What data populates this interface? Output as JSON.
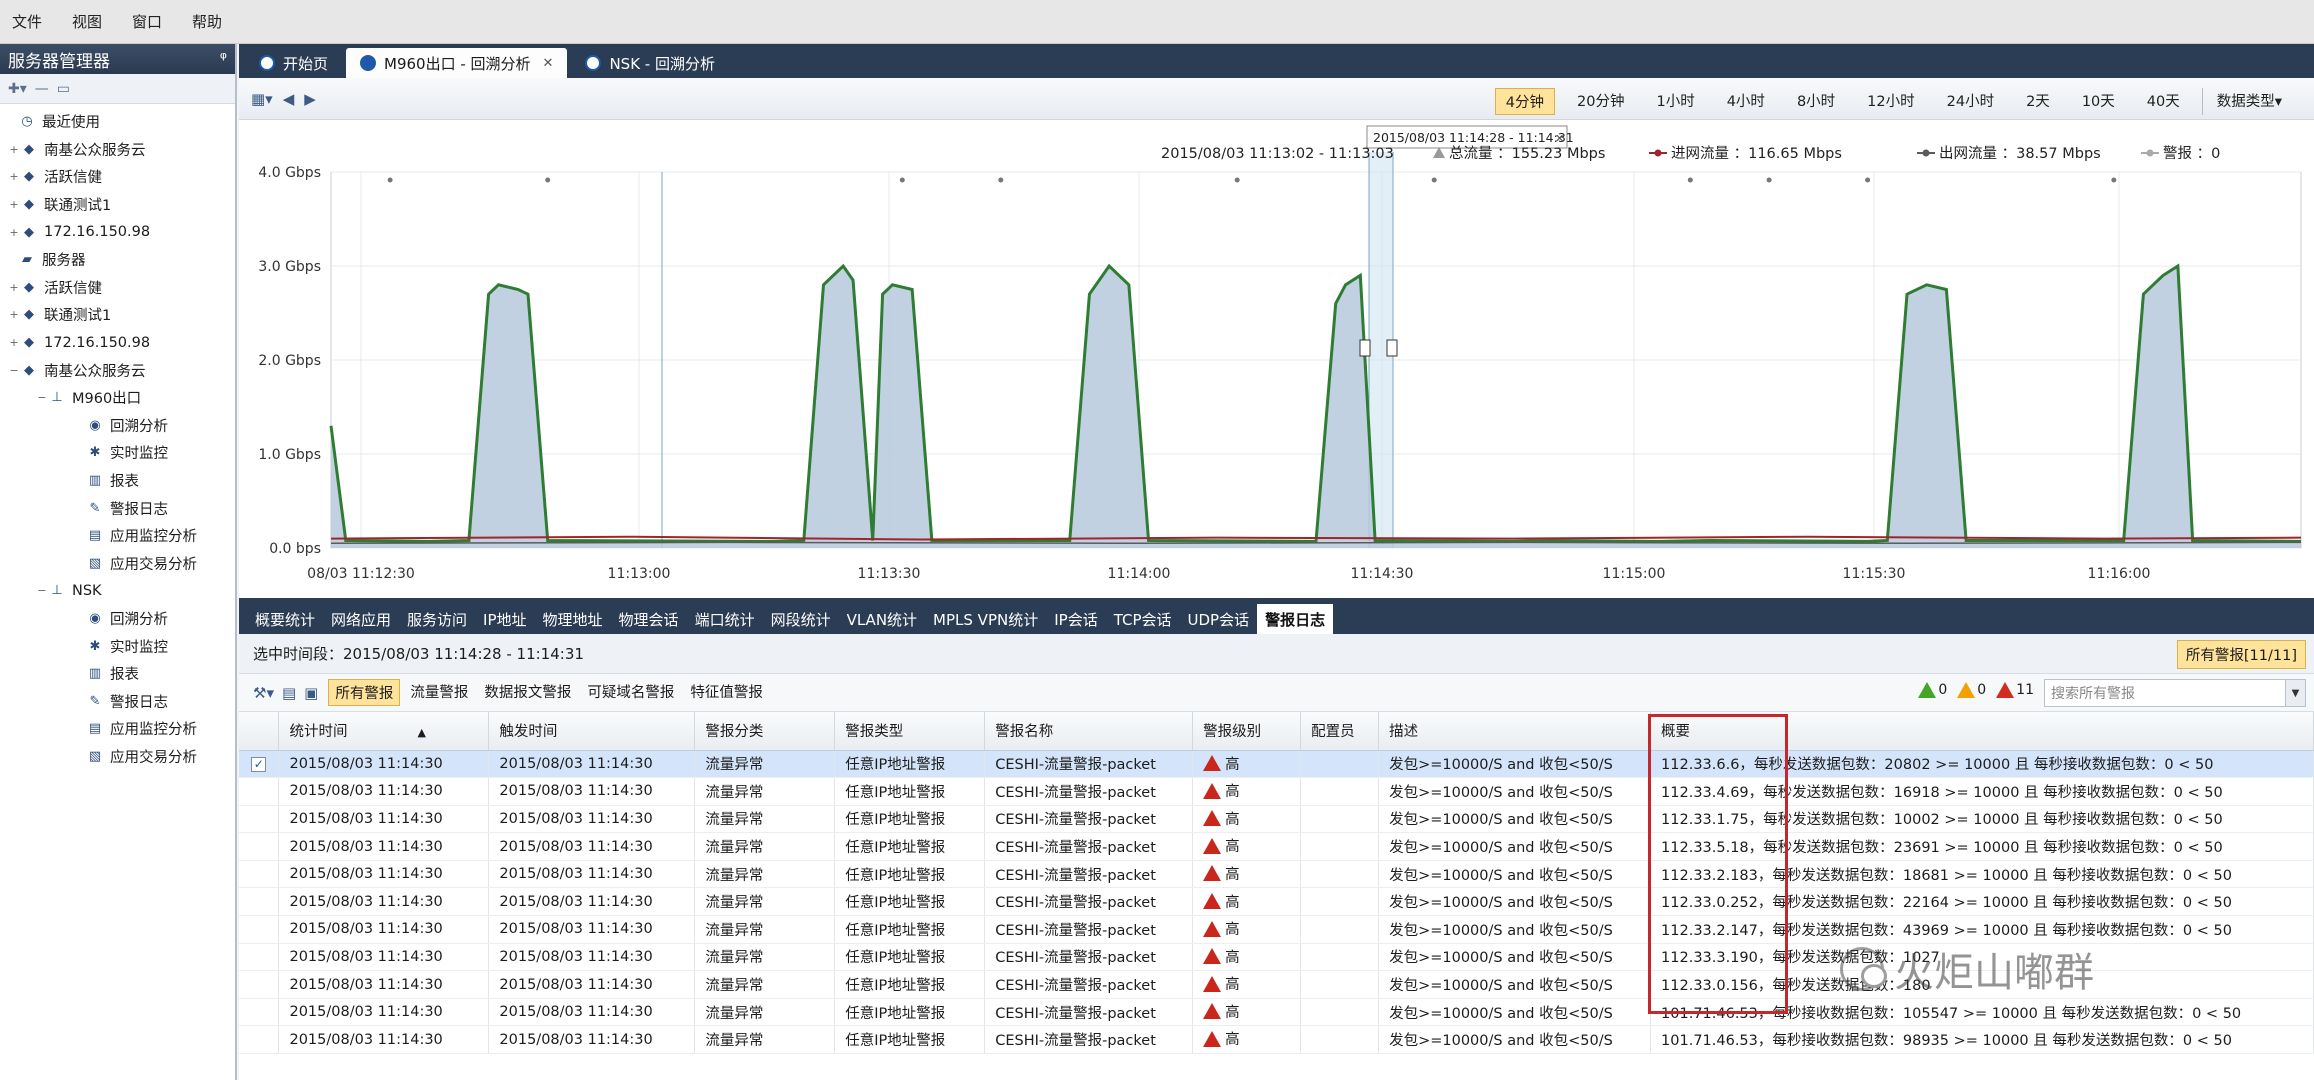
{
  "menu": [
    "文件",
    "视图",
    "窗口",
    "帮助"
  ],
  "left_panel": {
    "title": "服务器管理器",
    "pin": "ᵠ",
    "tree": [
      {
        "label": "最近使用",
        "level": 0,
        "icon": "clock-icon",
        "toggle": ""
      },
      {
        "label": "南基公众服务云",
        "level": 1,
        "icon": "server-icon",
        "toggle": "+"
      },
      {
        "label": "活跃信健",
        "level": 1,
        "icon": "server-icon",
        "toggle": "+"
      },
      {
        "label": "联通测试1",
        "level": 1,
        "icon": "server-icon",
        "toggle": "+"
      },
      {
        "label": "172.16.150.98",
        "level": 1,
        "icon": "server-icon",
        "toggle": "+"
      },
      {
        "label": "服务器",
        "level": 0,
        "icon": "folder-icon",
        "toggle": ""
      },
      {
        "label": "活跃信健",
        "level": 1,
        "icon": "server-icon",
        "toggle": "+"
      },
      {
        "label": "联通测试1",
        "level": 1,
        "icon": "server-icon",
        "toggle": "+"
      },
      {
        "label": "172.16.150.98",
        "level": 1,
        "icon": "server-icon",
        "toggle": "+"
      },
      {
        "label": "南基公众服务云",
        "level": 1,
        "icon": "server-icon",
        "toggle": "−"
      },
      {
        "label": "M960出口",
        "level": 2,
        "icon": "network-icon",
        "toggle": "−"
      },
      {
        "label": "回溯分析",
        "level": 3,
        "icon": "replay-icon",
        "toggle": ""
      },
      {
        "label": "实时监控",
        "level": 3,
        "icon": "monitor-icon",
        "toggle": ""
      },
      {
        "label": "报表",
        "level": 3,
        "icon": "report-icon",
        "toggle": ""
      },
      {
        "label": "警报日志",
        "level": 3,
        "icon": "log-icon",
        "toggle": ""
      },
      {
        "label": "应用监控分析",
        "level": 3,
        "icon": "app-monitor-icon",
        "toggle": ""
      },
      {
        "label": "应用交易分析",
        "level": 3,
        "icon": "app-trade-icon",
        "toggle": ""
      },
      {
        "label": "NSK",
        "level": 2,
        "icon": "network-icon",
        "toggle": "−"
      },
      {
        "label": "回溯分析",
        "level": 3,
        "icon": "replay-icon",
        "toggle": ""
      },
      {
        "label": "实时监控",
        "level": 3,
        "icon": "monitor-icon",
        "toggle": ""
      },
      {
        "label": "报表",
        "level": 3,
        "icon": "report-icon",
        "toggle": ""
      },
      {
        "label": "警报日志",
        "level": 3,
        "icon": "log-icon",
        "toggle": ""
      },
      {
        "label": "应用监控分析",
        "level": 3,
        "icon": "app-monitor-icon",
        "toggle": ""
      },
      {
        "label": "应用交易分析",
        "level": 3,
        "icon": "app-trade-icon",
        "toggle": ""
      }
    ]
  },
  "doc_tabs": [
    {
      "label": "开始页",
      "active": false,
      "closable": false
    },
    {
      "label": "M960出口 - 回溯分析",
      "active": true,
      "closable": true
    },
    {
      "label": "NSK - 回溯分析",
      "active": false,
      "closable": false
    }
  ],
  "time_ranges": [
    "4分钟",
    "20分钟",
    "1小时",
    "4小时",
    "8小时",
    "12小时",
    "24小时",
    "2天",
    "10天",
    "40天"
  ],
  "active_range": "4分钟",
  "data_type_label": "数据类型",
  "chart_data": {
    "type": "area",
    "tooltip": "2015/08/03 11:14:28 - 11:14:31",
    "legend": {
      "range": "2015/08/03  11:13:02 - 11:13:03",
      "total": "总流量 ：155.23 Mbps",
      "in": "进网流量 ：116.65 Mbps",
      "out": "出网流量 ：38.57 Mbps",
      "alarm": "警报 ：0"
    },
    "y_ticks": [
      "4.0 Gbps",
      "3.0 Gbps",
      "2.0 Gbps",
      "1.0 Gbps",
      "0.0 bps"
    ],
    "x_ticks": [
      "08/03 11:12:30",
      "11:13:00",
      "11:13:30",
      "11:14:00",
      "11:14:30",
      "11:15:00",
      "11:15:30",
      "11:16:00"
    ],
    "ylim_gbps": [
      0,
      4
    ],
    "total_gbps": [
      [
        0.0,
        1.3
      ],
      [
        1.5,
        0.08
      ],
      [
        10,
        0.07
      ],
      [
        14,
        0.08
      ],
      [
        16,
        2.7
      ],
      [
        17,
        2.8
      ],
      [
        19,
        2.75
      ],
      [
        20,
        2.7
      ],
      [
        22,
        0.08
      ],
      [
        45,
        0.07
      ],
      [
        48,
        0.08
      ],
      [
        50,
        2.8
      ],
      [
        52,
        3.0
      ],
      [
        53,
        2.85
      ],
      [
        55,
        0.08
      ],
      [
        56,
        2.7
      ],
      [
        57,
        2.8
      ],
      [
        59,
        2.75
      ],
      [
        61,
        0.08
      ],
      [
        75,
        0.08
      ],
      [
        77,
        2.7
      ],
      [
        79,
        3.0
      ],
      [
        81,
        2.8
      ],
      [
        83,
        0.08
      ],
      [
        100,
        0.07
      ],
      [
        102,
        2.6
      ],
      [
        103,
        2.8
      ],
      [
        104.5,
        2.9
      ],
      [
        106,
        0.08
      ],
      [
        120,
        0.07
      ],
      [
        124,
        0.08
      ],
      [
        135,
        0.07
      ],
      [
        140,
        0.08
      ],
      [
        156,
        0.07
      ],
      [
        158,
        0.08
      ],
      [
        160,
        2.7
      ],
      [
        162,
        2.8
      ],
      [
        164,
        2.75
      ],
      [
        166,
        0.08
      ],
      [
        182,
        0.08
      ],
      [
        184,
        2.7
      ],
      [
        186,
        2.9
      ],
      [
        187.5,
        3.0
      ],
      [
        189,
        0.08
      ],
      [
        200,
        0.07
      ]
    ],
    "in_gbps": [
      [
        0,
        0.1
      ],
      [
        30,
        0.12
      ],
      [
        60,
        0.09
      ],
      [
        90,
        0.11
      ],
      [
        120,
        0.1
      ],
      [
        150,
        0.12
      ],
      [
        180,
        0.1
      ],
      [
        200,
        0.11
      ]
    ],
    "out_gbps": [
      [
        0,
        0.05
      ],
      [
        40,
        0.06
      ],
      [
        80,
        0.05
      ],
      [
        120,
        0.06
      ],
      [
        160,
        0.05
      ],
      [
        200,
        0.06
      ]
    ],
    "alarm_markers_sec": [
      6,
      22,
      58,
      68,
      92,
      112,
      138,
      146,
      156,
      181
    ],
    "x_range_sec": [
      0,
      200
    ],
    "colors": {
      "total": "#2e7d32",
      "fill": "#b7c9dd",
      "in": "#a3232b",
      "out": "#5b5b5b",
      "selection": "#cfe4f1"
    }
  },
  "stat_tabs": [
    "概要统计",
    "网络应用",
    "服务访问",
    "IP地址",
    "物理地址",
    "物理会话",
    "端口统计",
    "网段统计",
    "VLAN统计",
    "MPLS VPN统计",
    "IP会话",
    "TCP会话",
    "UDP会话",
    "警报日志"
  ],
  "active_stat_tab": "警报日志",
  "time_range": "选中时间段：2015/08/03  11:14:28 - 11:14:31",
  "alarm_count": "所有警报[11/11]",
  "filters": [
    "所有警报",
    "流量警报",
    "数据报文警报",
    "可疑域名警报",
    "特征值警报"
  ],
  "active_filter": "所有警报",
  "severity_counts": [
    {
      "count": "0",
      "color": "green"
    },
    {
      "count": "0",
      "color": "orange"
    },
    {
      "count": "11",
      "color": "red"
    }
  ],
  "search_placeholder": "搜索所有警报",
  "table": {
    "columns": [
      "统计时间",
      "触发时间",
      "警报分类",
      "警报类型",
      "警报名称",
      "警报级别",
      "配置员",
      "描述",
      "概要"
    ],
    "sort_indicator": "▲",
    "rows": [
      {
        "stat": "2015/08/03 11:14:30",
        "trigger": "2015/08/03 11:14:30",
        "category": "流量异常",
        "type": "任意IP地址警报",
        "name": "CESHI-流量警报-packet",
        "level": "高",
        "operator": "",
        "desc": "发包>=10000/S and 收包<50/S",
        "summary": "112.33.6.6，每秒发送数据包数：20802 >= 10000 且 每秒接收数据包数：0 < 50",
        "selected": true
      },
      {
        "stat": "2015/08/03 11:14:30",
        "trigger": "2015/08/03 11:14:30",
        "category": "流量异常",
        "type": "任意IP地址警报",
        "name": "CESHI-流量警报-packet",
        "level": "高",
        "operator": "",
        "desc": "发包>=10000/S and 收包<50/S",
        "summary": "112.33.4.69，每秒发送数据包数：16918 >= 10000 且 每秒接收数据包数：0 < 50",
        "selected": false
      },
      {
        "stat": "2015/08/03 11:14:30",
        "trigger": "2015/08/03 11:14:30",
        "category": "流量异常",
        "type": "任意IP地址警报",
        "name": "CESHI-流量警报-packet",
        "level": "高",
        "operator": "",
        "desc": "发包>=10000/S and 收包<50/S",
        "summary": "112.33.1.75，每秒发送数据包数：10002 >= 10000 且 每秒接收数据包数：0 < 50",
        "selected": false
      },
      {
        "stat": "2015/08/03 11:14:30",
        "trigger": "2015/08/03 11:14:30",
        "category": "流量异常",
        "type": "任意IP地址警报",
        "name": "CESHI-流量警报-packet",
        "level": "高",
        "operator": "",
        "desc": "发包>=10000/S and 收包<50/S",
        "summary": "112.33.5.18，每秒发送数据包数：23691 >= 10000 且 每秒接收数据包数：0 < 50",
        "selected": false
      },
      {
        "stat": "2015/08/03 11:14:30",
        "trigger": "2015/08/03 11:14:30",
        "category": "流量异常",
        "type": "任意IP地址警报",
        "name": "CESHI-流量警报-packet",
        "level": "高",
        "operator": "",
        "desc": "发包>=10000/S and 收包<50/S",
        "summary": "112.33.2.183，每秒发送数据包数：18681 >= 10000 且 每秒接收数据包数：0 < 50",
        "selected": false
      },
      {
        "stat": "2015/08/03 11:14:30",
        "trigger": "2015/08/03 11:14:30",
        "category": "流量异常",
        "type": "任意IP地址警报",
        "name": "CESHI-流量警报-packet",
        "level": "高",
        "operator": "",
        "desc": "发包>=10000/S and 收包<50/S",
        "summary": "112.33.0.252，每秒发送数据包数：22164 >= 10000 且 每秒接收数据包数：0 < 50",
        "selected": false
      },
      {
        "stat": "2015/08/03 11:14:30",
        "trigger": "2015/08/03 11:14:30",
        "category": "流量异常",
        "type": "任意IP地址警报",
        "name": "CESHI-流量警报-packet",
        "level": "高",
        "operator": "",
        "desc": "发包>=10000/S and 收包<50/S",
        "summary": "112.33.2.147，每秒发送数据包数：43969 >= 10000 且 每秒接收数据包数：0 < 50",
        "selected": false
      },
      {
        "stat": "2015/08/03 11:14:30",
        "trigger": "2015/08/03 11:14:30",
        "category": "流量异常",
        "type": "任意IP地址警报",
        "name": "CESHI-流量警报-packet",
        "level": "高",
        "operator": "",
        "desc": "发包>=10000/S and 收包<50/S",
        "summary": "112.33.3.190，每秒发送数据包数：1027",
        "selected": false
      },
      {
        "stat": "2015/08/03 11:14:30",
        "trigger": "2015/08/03 11:14:30",
        "category": "流量异常",
        "type": "任意IP地址警报",
        "name": "CESHI-流量警报-packet",
        "level": "高",
        "operator": "",
        "desc": "发包>=10000/S and 收包<50/S",
        "summary": "112.33.0.156，每秒发送数据包数：180",
        "selected": false
      },
      {
        "stat": "2015/08/03 11:14:30",
        "trigger": "2015/08/03 11:14:30",
        "category": "流量异常",
        "type": "任意IP地址警报",
        "name": "CESHI-流量警报-packet",
        "level": "高",
        "operator": "",
        "desc": "发包>=10000/S and 收包<50/S",
        "summary": "101.71.46.53，每秒接收数据包数：105547 >= 10000 且 每秒发送数据包数：0 < 50",
        "selected": false
      },
      {
        "stat": "2015/08/03 11:14:30",
        "trigger": "2015/08/03 11:14:30",
        "category": "流量异常",
        "type": "任意IP地址警报",
        "name": "CESHI-流量警报-packet",
        "level": "高",
        "operator": "",
        "desc": "发包>=10000/S and 收包<50/S",
        "summary": "101.71.46.53，每秒接收数据包数：98935 >= 10000 且 每秒发送数据包数：0 < 50",
        "selected": false
      }
    ]
  },
  "watermark": "火炬山嘟群"
}
